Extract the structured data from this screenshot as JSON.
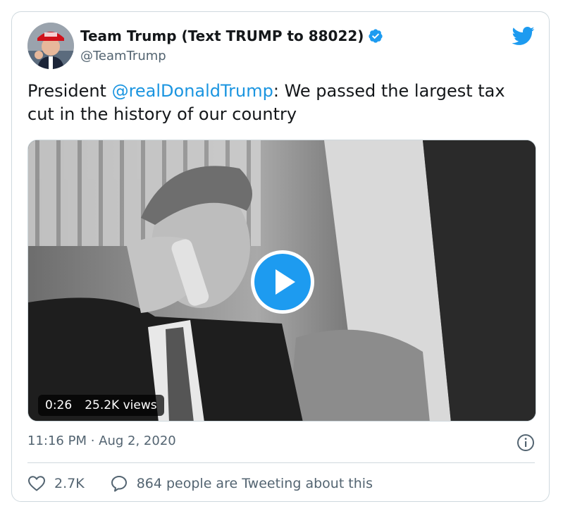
{
  "tweet": {
    "author": {
      "name": "Team Trump (Text TRUMP to 88022)",
      "handle": "@TeamTrump",
      "verified": true,
      "avatar_icon": "profile-photo"
    },
    "text_prefix": "President ",
    "mention": "@realDonaldTrump",
    "text_suffix": ": We passed the largest tax cut in the history of our country",
    "media": {
      "type": "video",
      "duration": "0:26",
      "views": "25.2K views"
    },
    "timestamp": "11:16 PM · Aug 2, 2020",
    "likes": "2.7K",
    "conversation": "864 people are Tweeting about this"
  },
  "colors": {
    "accent": "#1d9bf0",
    "mention": "#1b95e0",
    "secondary_text": "#536471",
    "border": "#cfd9de"
  },
  "icons": [
    "twitter-bird-icon",
    "verified-badge-icon",
    "play-icon",
    "info-icon",
    "heart-icon",
    "speech-bubble-icon"
  ]
}
